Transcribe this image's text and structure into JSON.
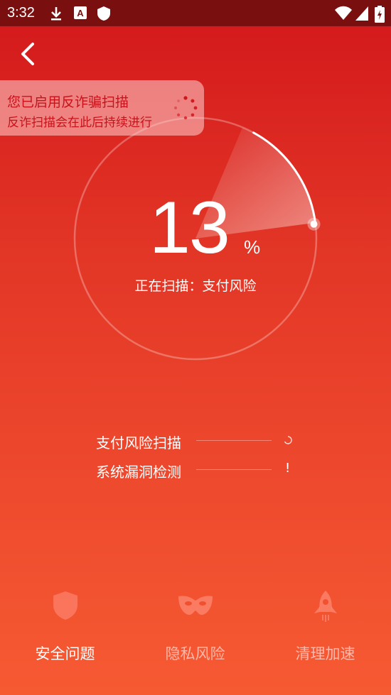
{
  "status_bar": {
    "time": "3:32",
    "icons": [
      "download-icon",
      "a-badge-icon",
      "shield-icon",
      "wifi-icon",
      "signal-icon",
      "battery-icon"
    ]
  },
  "toast": {
    "title": "您已启用反诈骗扫描",
    "subtitle": "反诈扫描会在此后持续进行"
  },
  "scan": {
    "progress_value": "13",
    "progress_unit": "%",
    "progress_fraction": 0.13,
    "status_text": "正在扫描：支付风险"
  },
  "tasks": [
    {
      "label": "支付风险扫描",
      "state": "scanning"
    },
    {
      "label": "系统漏洞检测",
      "state": "!"
    }
  ],
  "bottom_nav": [
    {
      "label": "安全问题",
      "icon": "shield-icon",
      "active": true
    },
    {
      "label": "隐私风险",
      "icon": "mask-icon",
      "active": false
    },
    {
      "label": "清理加速",
      "icon": "rocket-icon",
      "active": false
    }
  ],
  "colors": {
    "status_bar": "#7a0f0f",
    "bg_top": "#d3171b",
    "bg_bottom": "#f65a32",
    "toast_text": "#c8121a"
  }
}
